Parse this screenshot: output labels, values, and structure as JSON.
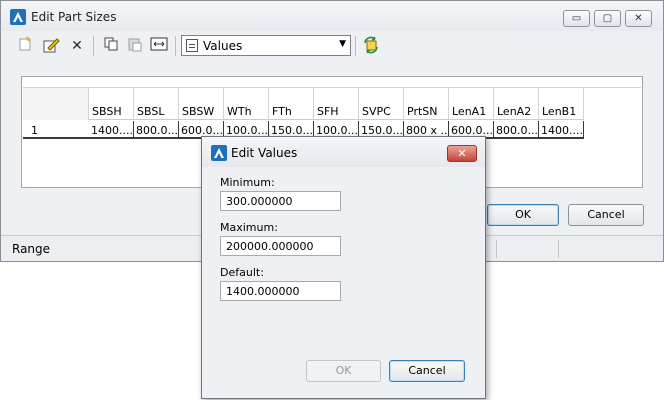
{
  "main_window": {
    "title": "Edit Part Sizes",
    "caption_buttons": {
      "minimize": "▭",
      "maximize": "▢",
      "close": "✕"
    },
    "toolbar": {
      "combo_value": "Values"
    },
    "grid": {
      "columns": [
        "SBSH",
        "SBSL",
        "SBSW",
        "WTh",
        "FTh",
        "SFH",
        "SVPC",
        "PrtSN",
        "LenA1",
        "LenA2",
        "LenB1"
      ],
      "rows": [
        {
          "index": "1",
          "cells": [
            "1400....",
            "800.0...",
            "600.0...",
            "100.0...",
            "150.0...",
            "100.0...",
            "150.0...",
            "800 x ...",
            "600.0...",
            "800.0...",
            "1400...."
          ]
        }
      ]
    },
    "ok_label": "OK",
    "cancel_label": "Cancel",
    "status_text": "Range"
  },
  "dialog": {
    "title": "Edit Values",
    "close_glyph": "✕",
    "minimum_label": "Minimum:",
    "minimum_value": "300.000000",
    "maximum_label": "Maximum:",
    "maximum_value": "200000.000000",
    "default_label": "Default:",
    "default_value": "1400.000000",
    "ok_label": "OK",
    "cancel_label": "Cancel"
  },
  "colors": {
    "app_icon": "#1f6fbf",
    "close_button": "#c5443a",
    "window_bg": "#eef0f3"
  }
}
